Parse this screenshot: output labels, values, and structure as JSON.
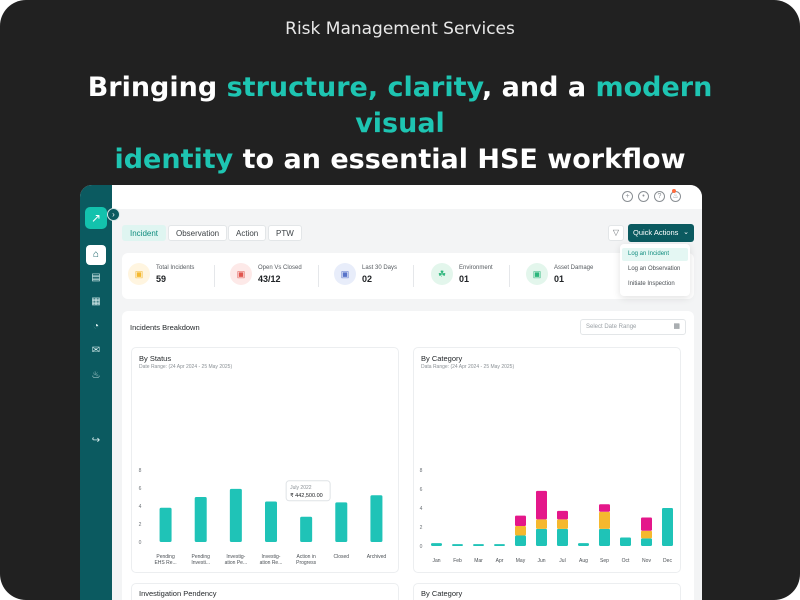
{
  "header": {
    "label": "Risk Management Services",
    "headline": {
      "part1": "Bringing ",
      "accent1": "structure, clarity",
      "part2": ", and a ",
      "accent2": "modern visual",
      "accent3": "identity",
      "part3": " to an essential HSE workflow"
    }
  },
  "colors": {
    "accent": "#1ec5b2",
    "sidebar": "#0b5a60",
    "bar_teal": "#1fc3b7",
    "bar_yellow": "#f5b82e",
    "bar_magenta": "#e4178a"
  },
  "sidebar": {
    "logo_icon": "trend-up-icon",
    "items": [
      {
        "icon": "home-icon",
        "active": true
      },
      {
        "icon": "report-icon",
        "active": false
      },
      {
        "icon": "grid-icon",
        "active": false
      },
      {
        "icon": "pie-chart-icon",
        "active": false
      },
      {
        "icon": "mail-icon",
        "active": false
      },
      {
        "icon": "bell-icon",
        "active": false
      },
      {
        "icon": "logout-icon",
        "active": false
      }
    ]
  },
  "topbar": {
    "icons": [
      "globe-icon",
      "chat-icon",
      "help-icon",
      "notification-bell-icon"
    ]
  },
  "tabs": [
    {
      "label": "Incident",
      "active": true
    },
    {
      "label": "Observation",
      "active": false
    },
    {
      "label": "Action",
      "active": false
    },
    {
      "label": "PTW",
      "active": false
    }
  ],
  "quick_actions": {
    "label": "Quick Actions",
    "menu": [
      "Log an Incident",
      "Log an Observation",
      "Initiate Inspection"
    ]
  },
  "kpis": [
    {
      "label": "Total Incidents",
      "value": "59",
      "icon": "car-icon",
      "color": "#f5b82e",
      "bg": "#fff5e0"
    },
    {
      "label": "Open Vs Closed",
      "value": "43/12",
      "icon": "car-icon",
      "color": "#e0564f",
      "bg": "#fde9e8"
    },
    {
      "label": "Last 30 Days",
      "value": "02",
      "icon": "car-icon",
      "color": "#5873c9",
      "bg": "#e8edfa"
    },
    {
      "label": "Environment",
      "value": "01",
      "icon": "leaf-icon",
      "color": "#2db67c",
      "bg": "#e3f6ec"
    },
    {
      "label": "Asset Damage",
      "value": "01",
      "icon": "car-icon",
      "color": "#2db67c",
      "bg": "#e3f6ec"
    }
  ],
  "breakdown": {
    "title": "Incidents Breakdown",
    "date_placeholder": "Select Date Range"
  },
  "chart_data": [
    {
      "type": "bar",
      "title": "By Status",
      "subtitle": "Date Range: (24 Apr 2024 - 25 May 2025)",
      "categories": [
        "Pending EHS Re...",
        "Pending Investi...",
        "Investig-ation Pe...",
        "Investig-ation Re...",
        "Action in Progress",
        "Closed",
        "Archived"
      ],
      "category_lines": [
        [
          "Pending",
          "EHS Re..."
        ],
        [
          "Pending",
          "Investi..."
        ],
        [
          "Investig-",
          "ation Pe..."
        ],
        [
          "Investig-",
          "ation Re..."
        ],
        [
          "Action in",
          "Progress"
        ],
        [
          "Closed"
        ],
        [
          "Archived"
        ]
      ],
      "values": [
        3.8,
        5.0,
        5.9,
        4.5,
        2.8,
        4.4,
        5.2
      ],
      "yticks": [
        0,
        2,
        4,
        6,
        8
      ],
      "ylim": [
        0,
        8
      ],
      "tooltip": {
        "month": "July 2022",
        "value": "₹ 442,500.00"
      }
    },
    {
      "type": "bar",
      "stacked": true,
      "title": "By Category",
      "subtitle": "Data Range: (24 Apr 2024 - 25 May 2025)",
      "categories": [
        "Jan",
        "Feb",
        "Mar",
        "Apr",
        "May",
        "Jun",
        "Jul",
        "Aug",
        "Sep",
        "Oct",
        "Nov",
        "Dec"
      ],
      "yticks": [
        0,
        2,
        4,
        6,
        8
      ],
      "ylim": [
        0,
        8
      ],
      "series": [
        {
          "color": "#1fc3b7",
          "values": [
            0.3,
            0.2,
            0.2,
            0.2,
            1.1,
            1.8,
            1.8,
            0.3,
            1.8,
            0.9,
            0.8,
            4.0
          ]
        },
        {
          "color": "#f5b82e",
          "values": [
            0,
            0,
            0,
            0,
            1.0,
            1.0,
            1.0,
            0,
            1.8,
            0,
            0.8,
            0
          ]
        },
        {
          "color": "#e4178a",
          "values": [
            0,
            0,
            0,
            0,
            1.1,
            3.0,
            0.9,
            0,
            0.8,
            0,
            1.4,
            0
          ]
        }
      ]
    }
  ],
  "bottom_cards": [
    "Investigation Pendency",
    "By Category"
  ]
}
